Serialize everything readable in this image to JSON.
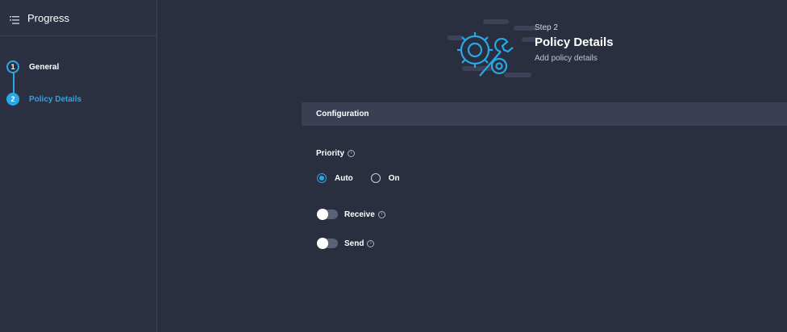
{
  "sidebar": {
    "title": "Progress",
    "steps": [
      {
        "number": "1",
        "label": "General",
        "state": "done"
      },
      {
        "number": "2",
        "label": "Policy Details",
        "state": "active"
      }
    ]
  },
  "header": {
    "step": "Step 2",
    "title": "Policy Details",
    "subtitle": "Add policy details"
  },
  "section": {
    "title": "Configuration"
  },
  "priority": {
    "label": "Priority",
    "options": [
      {
        "label": "Auto",
        "selected": true
      },
      {
        "label": "On",
        "selected": false
      }
    ]
  },
  "toggles": {
    "receive": {
      "label": "Receive",
      "enabled": false
    },
    "send": {
      "label": "Send",
      "enabled": false
    }
  },
  "colors": {
    "accent": "#2aa7e6",
    "background": "#2a2f40",
    "section_bar": "#3a3f54"
  },
  "icons": [
    "menu-list-icon",
    "gear-wrench-illustration",
    "info-icon"
  ]
}
